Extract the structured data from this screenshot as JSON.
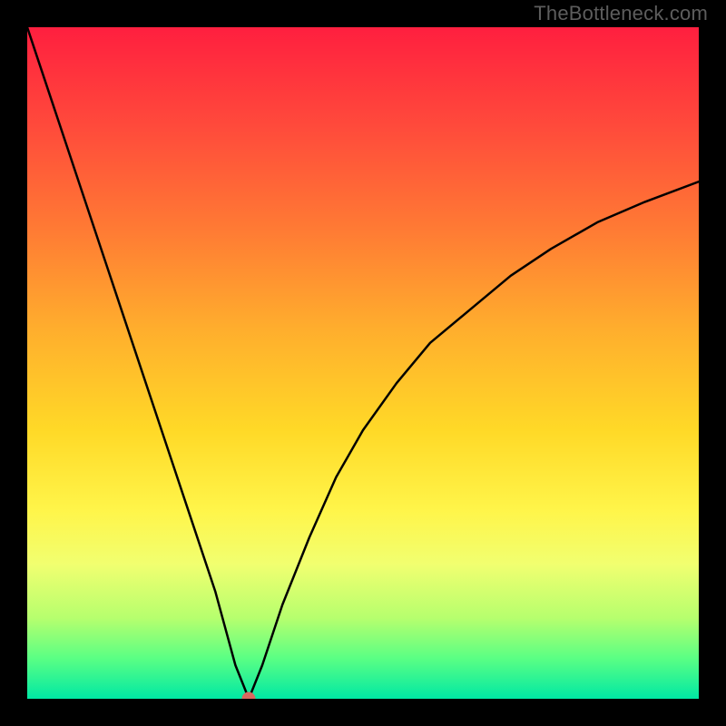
{
  "watermark": "TheBottleneck.com",
  "chart_data": {
    "type": "line",
    "title": "",
    "xlabel": "",
    "ylabel": "",
    "xlim": [
      0,
      100
    ],
    "ylim": [
      0,
      100
    ],
    "grid": false,
    "legend": false,
    "marker": {
      "x": 33,
      "y": 0,
      "color": "#d9695f"
    },
    "series": [
      {
        "name": "bottleneck-curve",
        "stroke": "#000000",
        "x": [
          0,
          4,
          8,
          12,
          16,
          20,
          24,
          28,
          31,
          33,
          35,
          38,
          42,
          46,
          50,
          55,
          60,
          66,
          72,
          78,
          85,
          92,
          100
        ],
        "y": [
          100,
          88,
          76,
          64,
          52,
          40,
          28,
          16,
          5,
          0,
          5,
          14,
          24,
          33,
          40,
          47,
          53,
          58,
          63,
          67,
          71,
          74,
          77
        ]
      }
    ],
    "background_gradient": [
      {
        "stop": 0.0,
        "hex": "#ff1f3f"
      },
      {
        "stop": 0.15,
        "hex": "#ff4b3b"
      },
      {
        "stop": 0.3,
        "hex": "#ff7a34"
      },
      {
        "stop": 0.45,
        "hex": "#ffae2d"
      },
      {
        "stop": 0.6,
        "hex": "#ffd927"
      },
      {
        "stop": 0.72,
        "hex": "#fff54a"
      },
      {
        "stop": 0.8,
        "hex": "#f1ff70"
      },
      {
        "stop": 0.88,
        "hex": "#b6ff6e"
      },
      {
        "stop": 0.94,
        "hex": "#5aff84"
      },
      {
        "stop": 1.0,
        "hex": "#00e8a4"
      }
    ]
  }
}
